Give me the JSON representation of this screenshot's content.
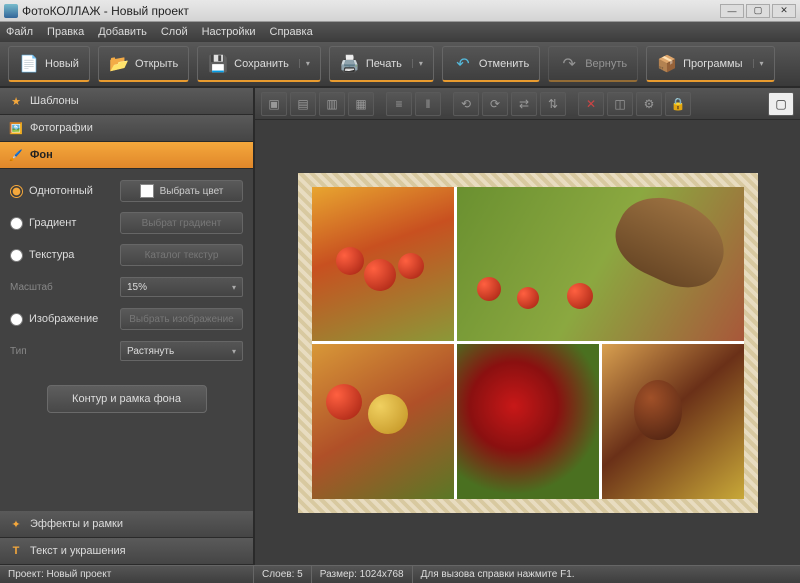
{
  "window": {
    "title": "ФотоКОЛЛАЖ - Новый проект"
  },
  "menu": {
    "file": "Файл",
    "edit": "Правка",
    "add": "Добавить",
    "layer": "Слой",
    "settings": "Настройки",
    "help": "Справка"
  },
  "toolbar": {
    "new": "Новый",
    "open": "Открыть",
    "save": "Сохранить",
    "print": "Печать",
    "undo": "Отменить",
    "redo": "Вернуть",
    "programs": "Программы"
  },
  "sidebar": {
    "templates": "Шаблоны",
    "photos": "Фотографии",
    "background": "Фон",
    "effects": "Эффекты и рамки",
    "text": "Текст и украшения"
  },
  "bgpanel": {
    "solid": "Однотонный",
    "pick_color": "Выбрать цвет",
    "gradient": "Градиент",
    "pick_gradient": "Выбрат градиент",
    "texture": "Текстура",
    "texture_catalog": "Каталог текстур",
    "scale_label": "Масштаб",
    "scale_value": "15%",
    "image": "Изображение",
    "pick_image": "Выбрать изображение",
    "type_label": "Тип",
    "type_value": "Растянуть",
    "outline_btn": "Контур и рамка фона"
  },
  "status": {
    "project": "Проект: Новый проект",
    "layers": "Слоев: 5",
    "size": "Размер: 1024x768",
    "help": "Для вызова справки нажмите F1."
  },
  "colors": {
    "accent": "#f5a83c"
  }
}
